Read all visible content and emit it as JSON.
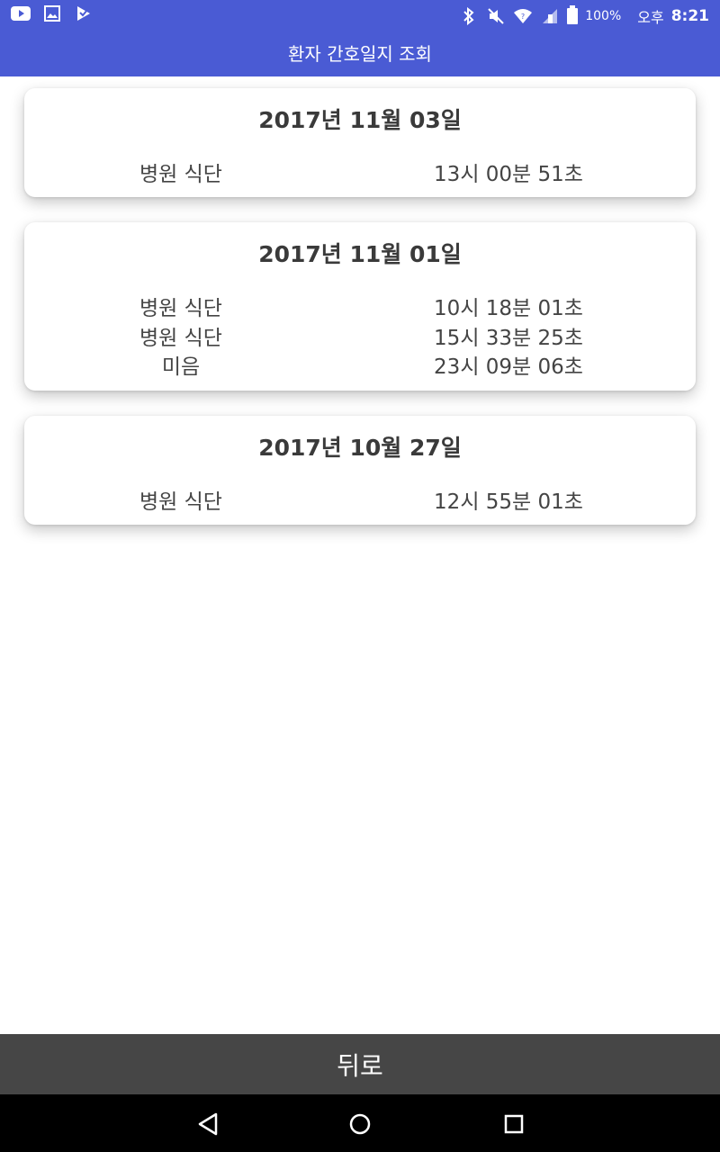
{
  "status_bar": {
    "battery_text": "100%",
    "ampm": "오후",
    "time": "8:21",
    "icons": [
      "youtube-icon",
      "gallery-icon",
      "app-icon",
      "bluetooth-icon",
      "mute-icon",
      "wifi-icon",
      "signal-icon",
      "battery-icon"
    ]
  },
  "app_bar": {
    "title": "환자 간호일지 조회"
  },
  "colors": {
    "accent": "#4a5bd4",
    "back_bar": "#464646",
    "nav_bar": "#000000"
  },
  "logs": [
    {
      "date": "2017년 11월 03일",
      "entries": [
        {
          "type": "병원 식단",
          "time": "13시 00분 51초"
        }
      ]
    },
    {
      "date": "2017년 11월 01일",
      "entries": [
        {
          "type": "병원 식단",
          "time": "10시 18분 01초"
        },
        {
          "type": "병원 식단",
          "time": "15시 33분 25초"
        },
        {
          "type": "미음",
          "time": "23시 09분 06초"
        }
      ]
    },
    {
      "date": "2017년 10월 27일",
      "entries": [
        {
          "type": "병원 식단",
          "time": "12시 55분 01초"
        }
      ]
    }
  ],
  "footer": {
    "back_label": "뒤로"
  }
}
